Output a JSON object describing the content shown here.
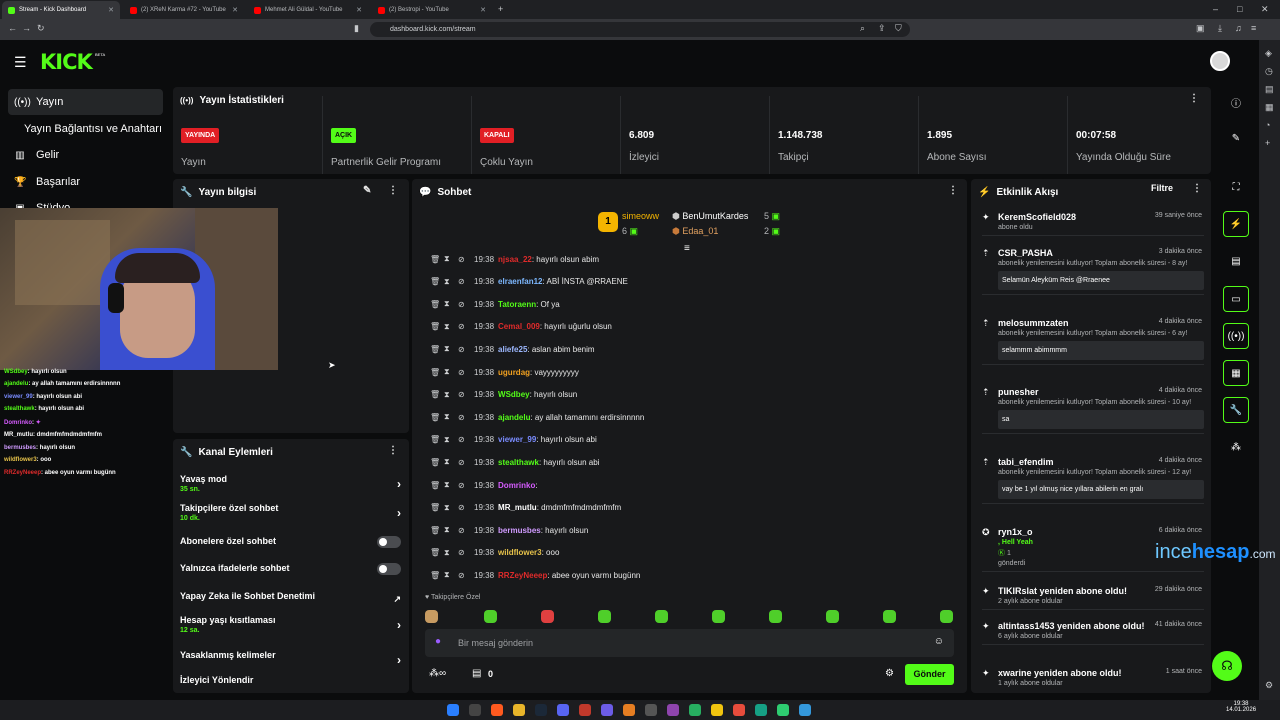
{
  "browser": {
    "tabs": [
      {
        "label": "Stream - Kick Dashboard",
        "active": true,
        "color": "#53fc18"
      },
      {
        "label": "(2) XReN Karma #72 - YouTube",
        "active": false,
        "color": "#ff0000"
      },
      {
        "label": "Mehmet Ali Güldal - YouTube",
        "active": false,
        "color": "#ff0000"
      },
      {
        "label": "(2) Bestropi - YouTube",
        "active": false,
        "color": "#ff0000"
      }
    ],
    "url": "dashboard.kick.com/stream"
  },
  "brand": {
    "logo": "KICK",
    "beta": "BETA",
    "accent": "#53fc18"
  },
  "nav": {
    "items": [
      {
        "label": "Yayın",
        "icon": "broadcast-icon",
        "active": true
      },
      {
        "label": "Yayın Bağlantısı ve Anahtarı",
        "icon": "",
        "active": false
      },
      {
        "label": "Gelir",
        "icon": "chart-icon",
        "active": false
      },
      {
        "label": "Başarılar",
        "icon": "trophy-icon",
        "active": false
      },
      {
        "label": "Stüdyo",
        "icon": "studio-icon",
        "active": false
      }
    ]
  },
  "stats": {
    "title": "Yayın İstatistikleri",
    "cells": [
      {
        "badge": "YAYINDA",
        "badge_color": "#e11f25",
        "label": "Yayın"
      },
      {
        "badge": "AÇIK",
        "badge_color": "#53fc18",
        "label": "Partnerlik Gelir Programı"
      },
      {
        "badge": "KAPALI",
        "badge_color": "#e11f25",
        "label": "Çoklu Yayın"
      },
      {
        "value": "6.809",
        "label": "İzleyici"
      },
      {
        "value": "1.148.738",
        "label": "Takipçi"
      },
      {
        "value": "1.895",
        "label": "Abone Sayısı"
      },
      {
        "value": "00:07:58",
        "label": "Yayında Olduğu Süre"
      }
    ]
  },
  "stream_info": {
    "title": "Yayın bilgisi"
  },
  "overlay_chat": [
    {
      "user": "WSdbey",
      "msg": ": hayırlı olsun",
      "color": "#53fc18"
    },
    {
      "user": "ajandelu",
      "msg": ": ay allah tamamını erdirsinnnnn",
      "color": "#53fc18"
    },
    {
      "user": "viewer_99",
      "msg": ": hayırlı olsun abi",
      "color": "#7a8cff"
    },
    {
      "user": "stealthawk",
      "msg": ": hayırlı olsun abi",
      "color": "#53fc18"
    },
    {
      "user": "Domrinko",
      "msg": ":",
      "color": "#d65cff"
    },
    {
      "user": "MR_mutlu",
      "msg": ": dmdmfmfmdmdmfmfm",
      "color": "#ffffff"
    },
    {
      "user": "bermusbes",
      "msg": ": hayırlı olsun",
      "color": "#d09bff"
    },
    {
      "user": "wildflower3",
      "msg": ": ooo",
      "color": "#e6c24a"
    },
    {
      "user": "RRZeyNeeep",
      "msg": ": abee oyun varmı bugünn",
      "color": "#e02b2b"
    }
  ],
  "channel_actions": {
    "title": "Kanal Eylemleri",
    "items": [
      {
        "label": "Yavaş mod",
        "sub": "35 sn.",
        "control": "arrow"
      },
      {
        "label": "Takipçilere özel sohbet",
        "sub": "10 dk.",
        "control": "arrow"
      },
      {
        "label": "Abonelere özel sohbet",
        "sub": "",
        "control": "toggle"
      },
      {
        "label": "Yalnızca ifadelerle sohbet",
        "sub": "",
        "control": "toggle"
      },
      {
        "label": "Yapay Zeka ile Sohbet Denetimi",
        "sub": "",
        "control": "external"
      },
      {
        "label": "Hesap yaşı kısıtlaması",
        "sub": "12 sa.",
        "control": "arrow"
      },
      {
        "label": "Yasaklanmış kelimeler",
        "sub": "",
        "control": "arrow"
      },
      {
        "label": "İzleyici Yönlendir",
        "sub": "",
        "control": ""
      }
    ]
  },
  "chat": {
    "title": "Sohbet",
    "leaders": [
      {
        "rank": "1",
        "name": "simeoww",
        "count": "6"
      },
      {
        "name": "BenUmutKardes",
        "count": "5"
      },
      {
        "name": "Edaa_01",
        "count": "2"
      }
    ],
    "messages": [
      {
        "time": "19:38",
        "user": "njsaa_22",
        "msg": ": hayırlı olsun abim",
        "color": "#e02b2b"
      },
      {
        "time": "19:38",
        "user": "elraenfan12",
        "msg": ": ABİ İNSTA @RRAENE",
        "color": "#7db8ff"
      },
      {
        "time": "19:38",
        "user": "Tatoraenn",
        "msg": ": Of ya",
        "color": "#53fc18"
      },
      {
        "time": "19:38",
        "user": "Cemal_009",
        "msg": ": hayırlı uğurlu olsun",
        "color": "#e02b2b"
      },
      {
        "time": "19:38",
        "user": "aliefe25",
        "msg": ": aslan abim benim",
        "color": "#9db8ff"
      },
      {
        "time": "19:38",
        "user": "ugurdag",
        "msg": ": vayyyyyyyyy",
        "color": "#f0a020"
      },
      {
        "time": "19:38",
        "user": "WSdbey",
        "msg": ": hayırlı olsun",
        "color": "#53fc18"
      },
      {
        "time": "19:38",
        "user": "ajandelu",
        "msg": ": ay allah tamamını erdirsinnnnn",
        "color": "#53fc18"
      },
      {
        "time": "19:38",
        "user": "viewer_99",
        "msg": ": hayırlı olsun abi",
        "color": "#7a8cff"
      },
      {
        "time": "19:38",
        "user": "stealthawk",
        "msg": ": hayırlı olsun abi",
        "color": "#53fc18"
      },
      {
        "time": "19:38",
        "user": "Domrinko",
        "msg": ":",
        "color": "#d65cff"
      },
      {
        "time": "19:38",
        "user": "MR_mutlu",
        "msg": ": dmdmfmfmdmdmfmfm",
        "color": "#ffffff"
      },
      {
        "time": "19:38",
        "user": "bermusbes",
        "msg": ": hayırlı olsun",
        "color": "#d09bff"
      },
      {
        "time": "19:38",
        "user": "wildflower3",
        "msg": ": ooo",
        "color": "#e6c24a"
      },
      {
        "time": "19:38",
        "user": "RRZeyNeeep",
        "msg": ": abee oyun varmı bugünn",
        "color": "#e02b2b"
      }
    ],
    "emote_section": "Takipçilere Özel",
    "input_placeholder": "Bir mesaj gönderin",
    "send_label": "Gönder",
    "bottom_count": "0"
  },
  "activity": {
    "title": "Etkinlik Akışı",
    "filter": "Filtre",
    "items": [
      {
        "name": "KeremScofield028",
        "time": "39 saniye önce",
        "sub": "abone oldu",
        "box": ""
      },
      {
        "name": "CSR_PASHA",
        "time": "3 dakika önce",
        "sub": "abonelik yenilemesini kutluyor! Toplam abonelik süresi - 8 ay!",
        "box": "Selamün Aleyküm Reis @Rraenee"
      },
      {
        "name": "melosummzaten",
        "time": "4 dakika önce",
        "sub": "abonelik yenilemesini kutluyor! Toplam abonelik süresi - 6 ay!",
        "box": "selammm abimmmm"
      },
      {
        "name": "punesher",
        "time": "4 dakika önce",
        "sub": "abonelik yenilemesini kutluyor! Toplam abonelik süresi - 10 ay!",
        "box": "sa"
      },
      {
        "name": "tabi_efendim",
        "time": "4 dakika önce",
        "sub": "abonelik yenilemesini kutluyor! Toplam abonelik süresi - 12 ay!",
        "box": "vay be 1 yıl olmuş nice yıllara abilerin en gralı"
      },
      {
        "name": "ryn1x_o",
        "time": "6 dakika önce",
        "sub": ", Hell Yeah",
        "extra": "1",
        "extra2": "gönderdi",
        "box": ""
      },
      {
        "name": "TIKIRslat yeniden abone oldu!",
        "time": "29 dakika önce",
        "sub": "2 aylık abone oldular",
        "box": ""
      },
      {
        "name": "altintass1453 yeniden abone oldu!",
        "time": "41 dakika önce",
        "sub": "6 aylık abone oldular",
        "box": ""
      },
      {
        "name": "xwarine yeniden abone oldu!",
        "time": "1 saat önce",
        "sub": "1 aylık abone oldular",
        "box": ""
      }
    ]
  },
  "watermark": {
    "a": "ince",
    "b": "hesap",
    "c": ".com"
  },
  "taskbar": {
    "time": "19:38",
    "date": "14.01.2026"
  }
}
